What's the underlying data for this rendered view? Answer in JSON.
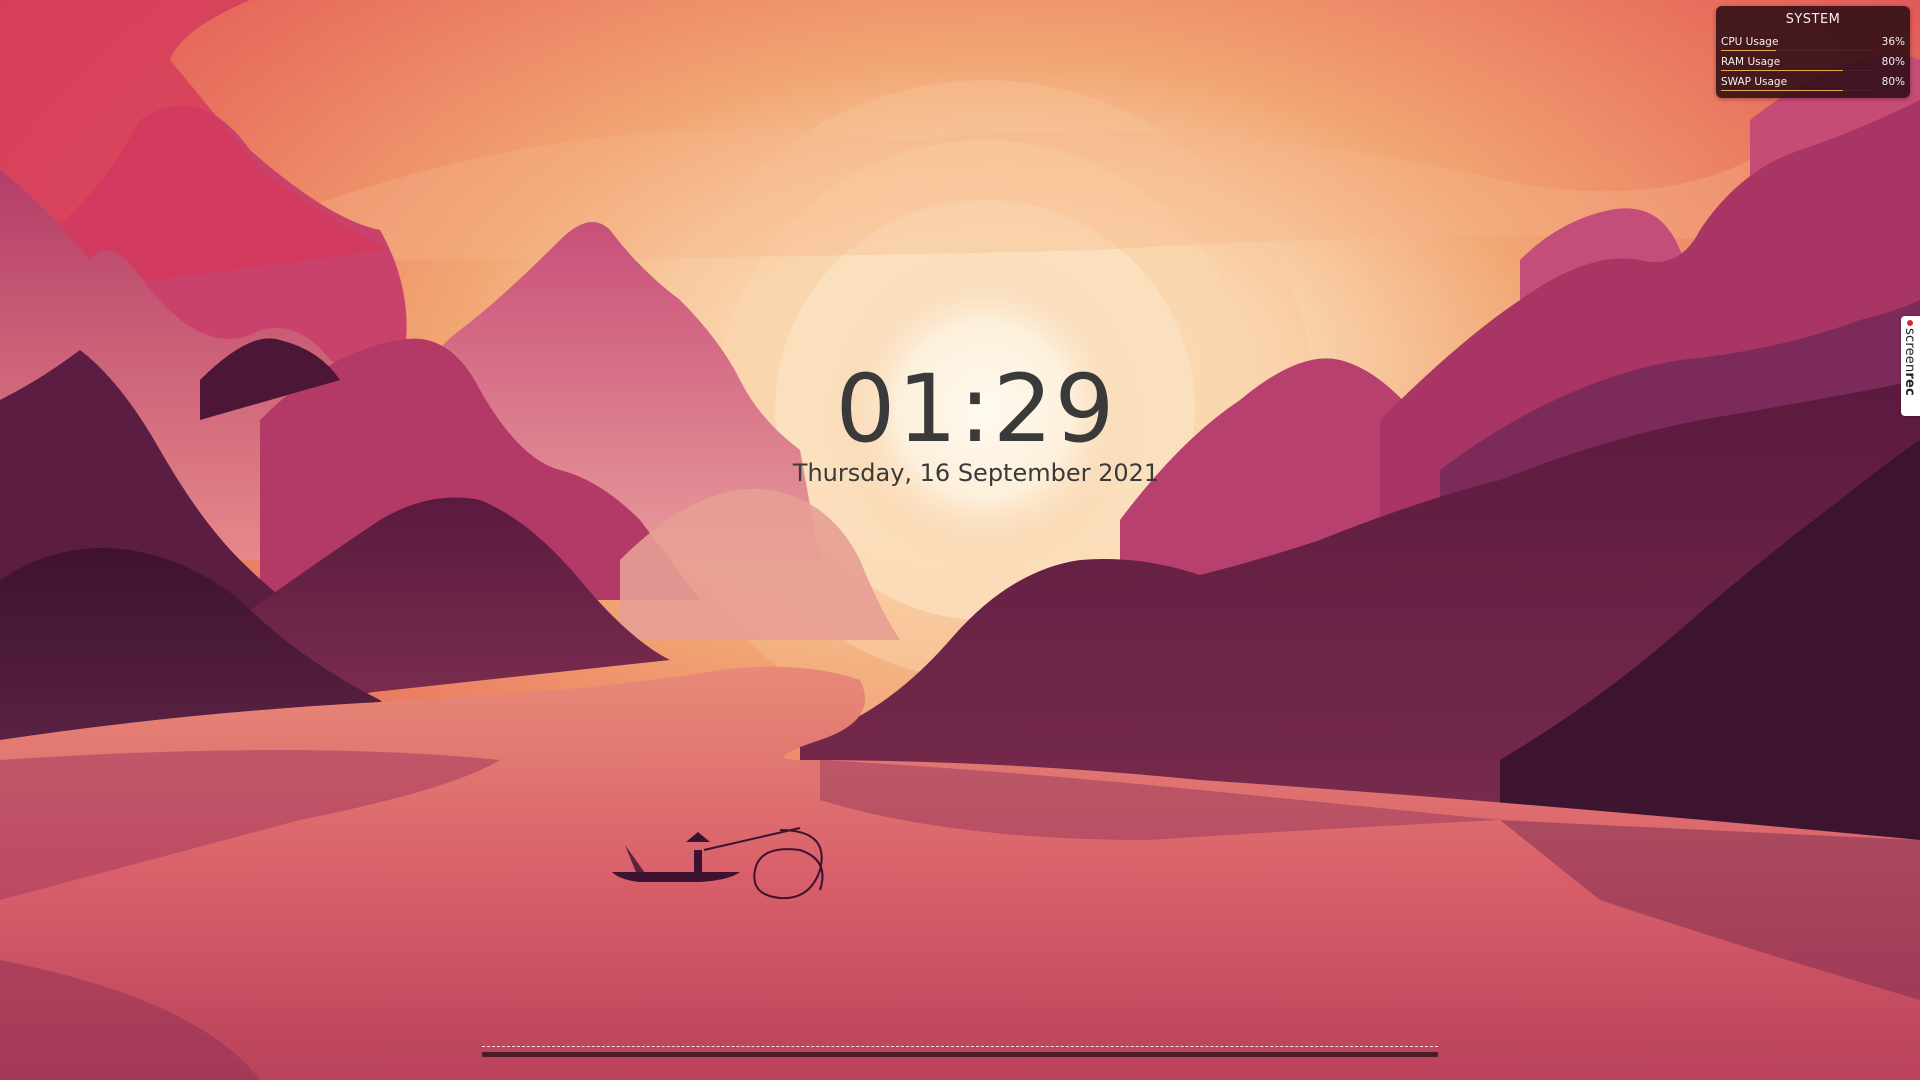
{
  "clock": {
    "time": "01:29",
    "date": "Thursday, 16 September 2021"
  },
  "system_monitor": {
    "title": "SYSTEM",
    "bar_color": "#e2a84a",
    "rows": [
      {
        "label": "CPU Usage",
        "value": "36%",
        "fraction": 0.36
      },
      {
        "label": "RAM Usage",
        "value": "80%",
        "fraction": 0.8
      },
      {
        "label": "SWAP Usage",
        "value": "80%",
        "fraction": 0.8
      }
    ]
  },
  "screenrec": {
    "prefix": "screen",
    "suffix": "rec",
    "dot_color": "#e3262e"
  },
  "wallpaper": {
    "subject": "mountain-river-sunset-icon",
    "sky_color": "#e88a6a",
    "sun_color": "#fff6e6"
  },
  "dock": {
    "name": "taskbar"
  }
}
